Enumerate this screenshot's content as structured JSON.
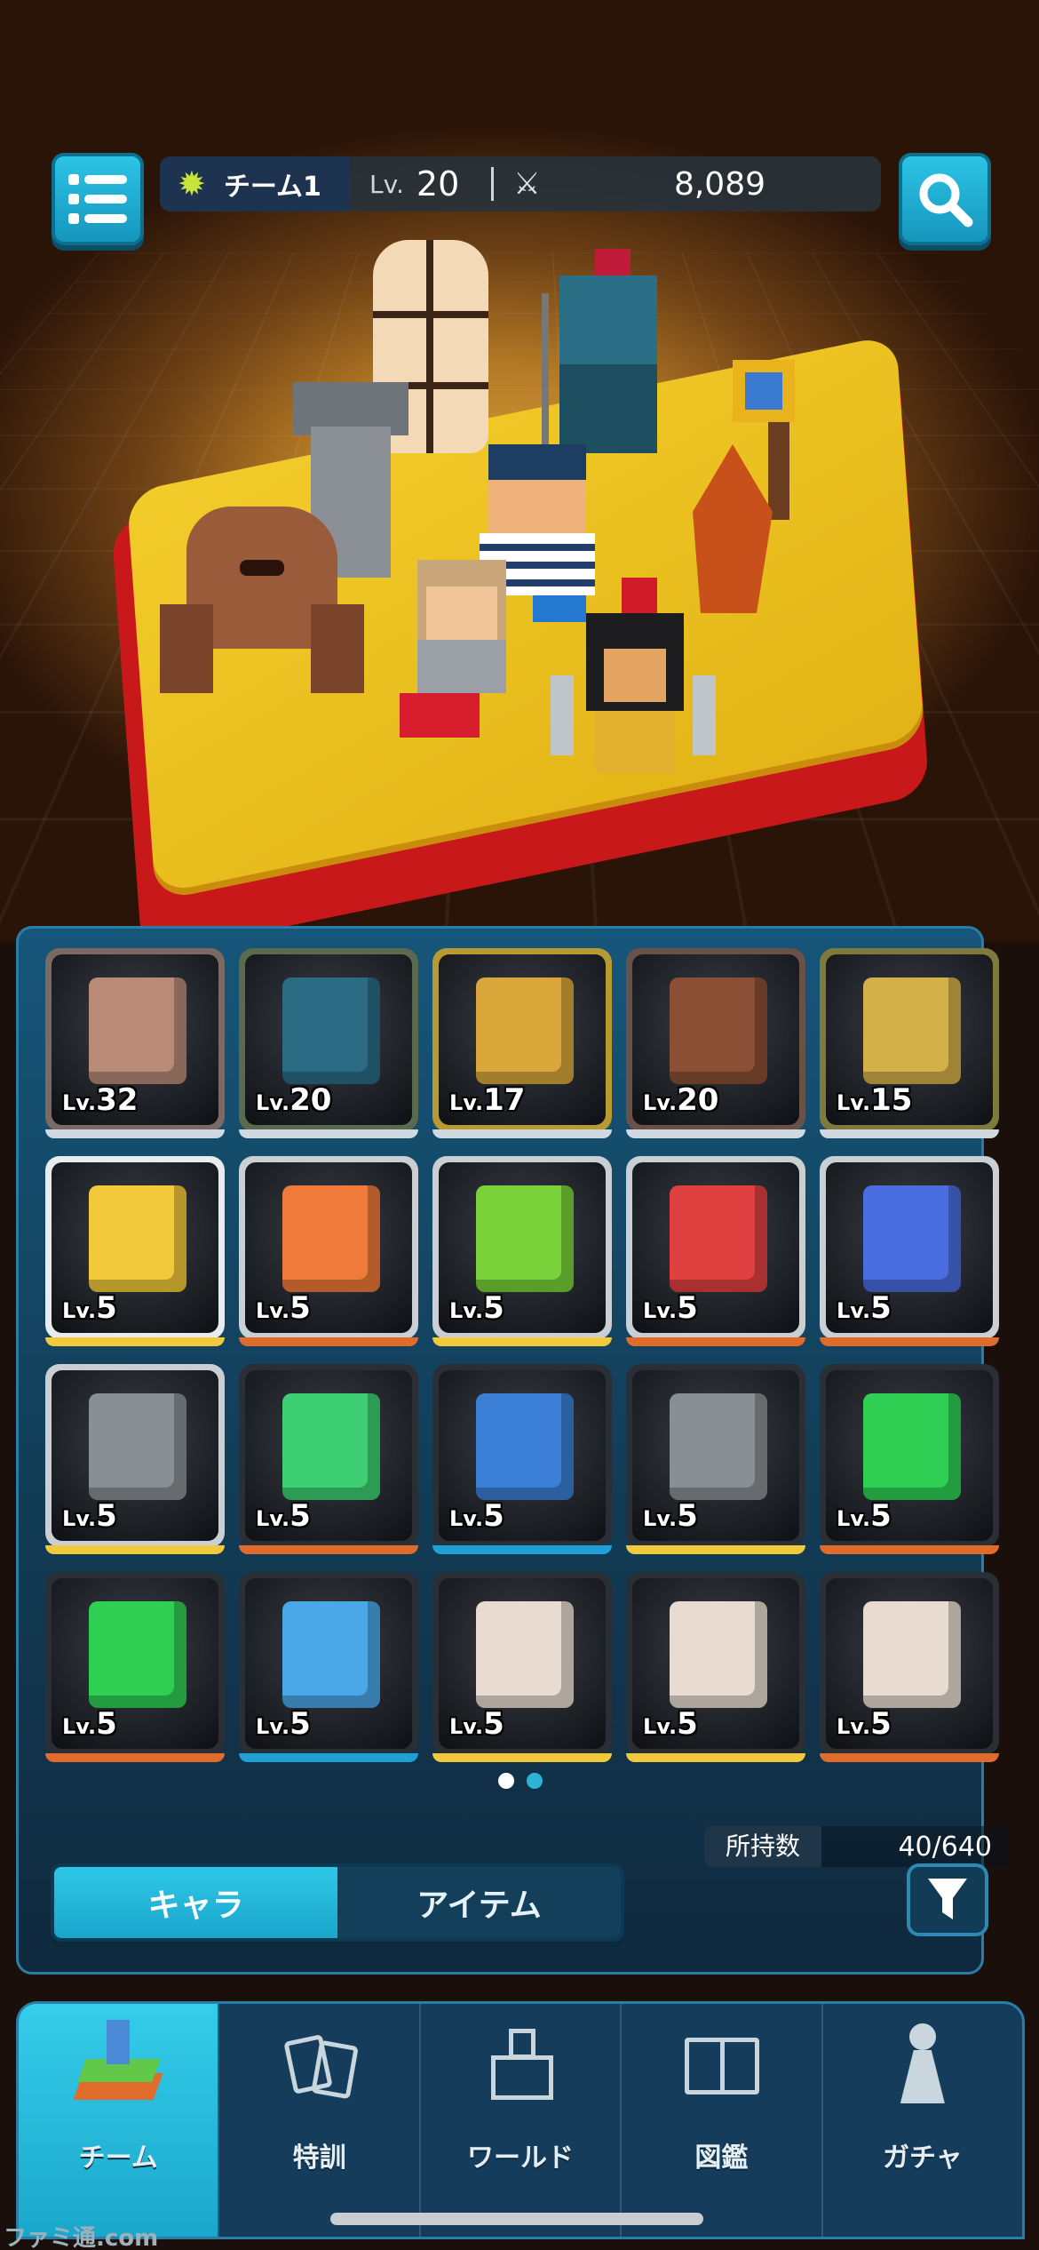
{
  "hud": {
    "menu_icon": "list-icon",
    "search_icon": "search-icon",
    "team_name": "チーム1",
    "level_label": "Lv.",
    "level": "20",
    "power": "8,089"
  },
  "characters": [
    {
      "lv_prefix": "Lv.",
      "lv": "32",
      "frame": "#7a6a63",
      "accent": "#b98b77"
    },
    {
      "lv_prefix": "Lv.",
      "lv": "20",
      "frame": "#5a6a4e",
      "accent": "#2b6b84"
    },
    {
      "lv_prefix": "Lv.",
      "lv": "17",
      "frame": "#b89a33",
      "accent": "#d9a73a"
    },
    {
      "lv_prefix": "Lv.",
      "lv": "20",
      "frame": "#6a5148",
      "accent": "#8b4f35"
    },
    {
      "lv_prefix": "Lv.",
      "lv": "15",
      "frame": "#7f7a3b",
      "accent": "#d4b04a"
    },
    {
      "lv_prefix": "Lv.",
      "lv": "5",
      "frame": "#e8ecee",
      "accent": "#f2c93a"
    },
    {
      "lv_prefix": "Lv.",
      "lv": "5",
      "frame": "#c9cfd3",
      "accent": "#f07a3a"
    },
    {
      "lv_prefix": "Lv.",
      "lv": "5",
      "frame": "#c9cfd3",
      "accent": "#79d23a"
    },
    {
      "lv_prefix": "Lv.",
      "lv": "5",
      "frame": "#c9cfd3",
      "accent": "#e04040"
    },
    {
      "lv_prefix": "Lv.",
      "lv": "5",
      "frame": "#c9cfd3",
      "accent": "#4a6de0"
    },
    {
      "lv_prefix": "Lv.",
      "lv": "5",
      "frame": "#c9cfd3",
      "accent": "#8a8f93"
    },
    {
      "lv_prefix": "Lv.",
      "lv": "5",
      "frame": "#2a2f35",
      "accent": "#3ecf72"
    },
    {
      "lv_prefix": "Lv.",
      "lv": "5",
      "frame": "#2a2f35",
      "accent": "#3b7fd6"
    },
    {
      "lv_prefix": "Lv.",
      "lv": "5",
      "frame": "#2a2f35",
      "accent": "#8a8f93"
    },
    {
      "lv_prefix": "Lv.",
      "lv": "5",
      "frame": "#2a2f35",
      "accent": "#2fcf54"
    },
    {
      "lv_prefix": "Lv.",
      "lv": "5",
      "frame": "#2a2f35",
      "accent": "#2fcf54"
    },
    {
      "lv_prefix": "Lv.",
      "lv": "5",
      "frame": "#2a2f35",
      "accent": "#4aa8e8"
    },
    {
      "lv_prefix": "Lv.",
      "lv": "5",
      "frame": "#2a2f35",
      "accent": "#e8dcd2"
    },
    {
      "lv_prefix": "Lv.",
      "lv": "5",
      "frame": "#2a2f35",
      "accent": "#e8dcd2"
    },
    {
      "lv_prefix": "Lv.",
      "lv": "5",
      "frame": "#2a2f35",
      "accent": "#e8dcd2"
    }
  ],
  "underline_colors": [
    "#d0d9df",
    "#d0d9df",
    "#d0d9df",
    "#d0d9df",
    "#d0d9df",
    "#f2c93a",
    "#e06b2a",
    "#f2c93a",
    "#e06b2a",
    "#e06b2a",
    "#f2c93a",
    "#e06b2a",
    "#1ea0d6",
    "#f2c93a",
    "#e06b2a",
    "#e06b2a",
    "#1ea0d6",
    "#f2c93a",
    "#f2c93a",
    "#e06b2a"
  ],
  "pagination": {
    "current": 1,
    "total": 2
  },
  "inventory": {
    "label": "所持数",
    "value": "40/640"
  },
  "tabs": {
    "characters": "キャラ",
    "items": "アイテム",
    "filter_icon": "filter-icon"
  },
  "nav": [
    {
      "label": "チーム",
      "icon": "team-board-icon",
      "active": true
    },
    {
      "label": "特訓",
      "icon": "training-cards-icon",
      "active": false
    },
    {
      "label": "ワールド",
      "icon": "world-castle-icon",
      "active": false
    },
    {
      "label": "図鑑",
      "icon": "book-icon",
      "active": false
    },
    {
      "label": "ガチャ",
      "icon": "gacha-tower-icon",
      "active": false
    }
  ],
  "watermark": "ファミ通.com"
}
